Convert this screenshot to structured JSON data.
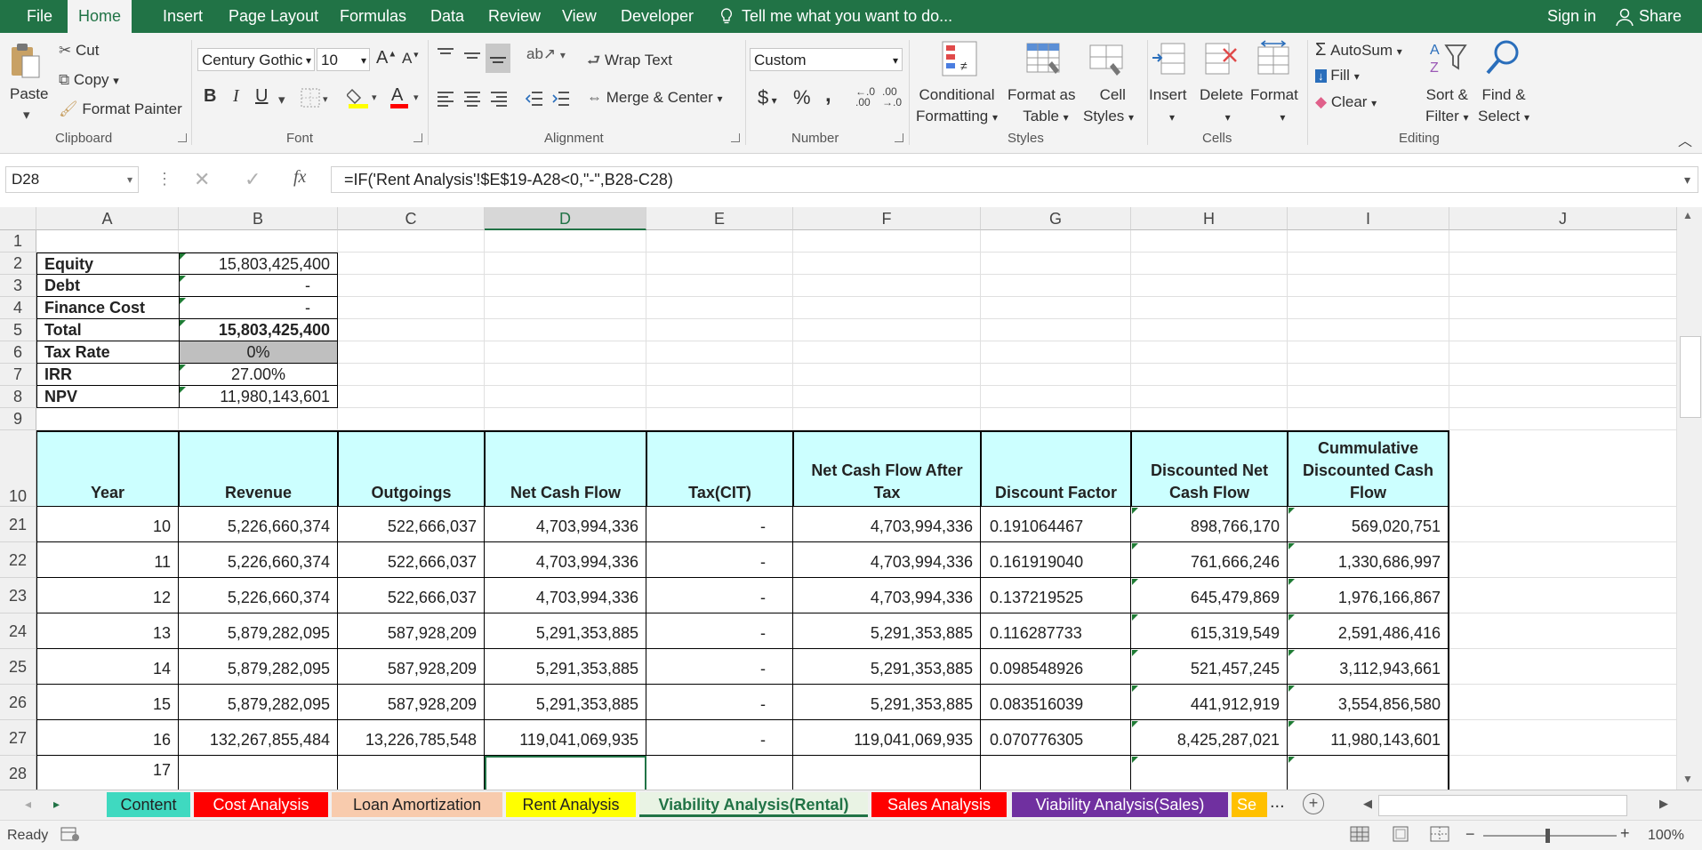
{
  "menu": {
    "file": "File",
    "home": "Home",
    "insert": "Insert",
    "page_layout": "Page Layout",
    "formulas": "Formulas",
    "data": "Data",
    "review": "Review",
    "view": "View",
    "developer": "Developer",
    "tell_me": "Tell me what you want to do...",
    "sign_in": "Sign in",
    "share": "Share"
  },
  "ribbon": {
    "clipboard": {
      "paste": "Paste",
      "cut": "Cut",
      "copy": "Copy",
      "format_painter": "Format Painter",
      "label": "Clipboard"
    },
    "font": {
      "name": "Century Gothic",
      "size": "10",
      "bold": "B",
      "italic": "I",
      "underline": "U",
      "label": "Font"
    },
    "alignment": {
      "wrap_text": "Wrap Text",
      "merge_center": "Merge & Center",
      "label": "Alignment"
    },
    "number": {
      "format": "Custom",
      "currency": "$",
      "percent": "%",
      "comma": ",",
      "label": "Number"
    },
    "styles": {
      "conditional_1": "Conditional",
      "conditional_2": "Formatting",
      "format_as_1": "Format as",
      "format_as_2": "Table",
      "cell_styles_1": "Cell",
      "cell_styles_2": "Styles",
      "label": "Styles"
    },
    "cells": {
      "insert": "Insert",
      "delete": "Delete",
      "format": "Format",
      "label": "Cells"
    },
    "editing": {
      "autosum": "AutoSum",
      "fill": "Fill",
      "clear": "Clear",
      "sort_1": "Sort &",
      "sort_2": "Filter",
      "find_1": "Find &",
      "find_2": "Select",
      "label": "Editing"
    }
  },
  "formula_bar": {
    "name_box": "D28",
    "fx": "fx",
    "formula": "=IF('Rent Analysis'!$E$19-A28<0,\"-\",B28-C28)"
  },
  "columns": [
    "A",
    "B",
    "C",
    "D",
    "E",
    "F",
    "G",
    "H",
    "I",
    "J"
  ],
  "summary": [
    {
      "row": "1",
      "label": "",
      "value": ""
    },
    {
      "row": "2",
      "label": "Equity",
      "value": "15,803,425,400"
    },
    {
      "row": "3",
      "label": "Debt",
      "value": "-"
    },
    {
      "row": "4",
      "label": "Finance Cost",
      "value": "-"
    },
    {
      "row": "5",
      "label": "Total",
      "value": "15,803,425,400"
    },
    {
      "row": "6",
      "label": "Tax Rate",
      "value": "0%"
    },
    {
      "row": "7",
      "label": "IRR",
      "value": "27.00%"
    },
    {
      "row": "8",
      "label": "NPV",
      "value": "11,980,143,601"
    },
    {
      "row": "9",
      "label": "",
      "value": ""
    }
  ],
  "table_header": {
    "row": "10",
    "cells": [
      "Year",
      "Revenue",
      "Outgoings",
      "Net Cash Flow",
      "Tax(CIT)",
      "Net Cash Flow After Tax",
      "Discount Factor",
      "Discounted Net Cash Flow",
      "Cummulative Discounted Cash Flow"
    ]
  },
  "table_rows": [
    {
      "row": "21",
      "cells": [
        "10",
        "5,226,660,374",
        "522,666,037",
        "4,703,994,336",
        "-",
        "4,703,994,336",
        "0.191064467",
        "898,766,170",
        "569,020,751"
      ]
    },
    {
      "row": "22",
      "cells": [
        "11",
        "5,226,660,374",
        "522,666,037",
        "4,703,994,336",
        "-",
        "4,703,994,336",
        "0.161919040",
        "761,666,246",
        "1,330,686,997"
      ]
    },
    {
      "row": "23",
      "cells": [
        "12",
        "5,226,660,374",
        "522,666,037",
        "4,703,994,336",
        "-",
        "4,703,994,336",
        "0.137219525",
        "645,479,869",
        "1,976,166,867"
      ]
    },
    {
      "row": "24",
      "cells": [
        "13",
        "5,879,282,095",
        "587,928,209",
        "5,291,353,885",
        "-",
        "5,291,353,885",
        "0.116287733",
        "615,319,549",
        "2,591,486,416"
      ]
    },
    {
      "row": "25",
      "cells": [
        "14",
        "5,879,282,095",
        "587,928,209",
        "5,291,353,885",
        "-",
        "5,291,353,885",
        "0.098548926",
        "521,457,245",
        "3,112,943,661"
      ]
    },
    {
      "row": "26",
      "cells": [
        "15",
        "5,879,282,095",
        "587,928,209",
        "5,291,353,885",
        "-",
        "5,291,353,885",
        "0.083516039",
        "441,912,919",
        "3,554,856,580"
      ]
    },
    {
      "row": "27",
      "cells": [
        "16",
        "132,267,855,484",
        "13,226,785,548",
        "119,041,069,935",
        "-",
        "119,041,069,935",
        "0.070776305",
        "8,425,287,021",
        "11,980,143,601"
      ]
    },
    {
      "row": "28",
      "cells": [
        "17",
        "",
        "",
        "",
        "",
        "",
        "",
        "",
        ""
      ]
    }
  ],
  "sheet_tabs": [
    {
      "label": "Content",
      "color": "#3fd9c0"
    },
    {
      "label": "Cost Analysis",
      "color": "#ff0000"
    },
    {
      "label": "Loan Amortization",
      "color": "#f8cbad"
    },
    {
      "label": "Rent Analysis",
      "color": "#ffff00"
    },
    {
      "label": "Viability Analysis(Rental)",
      "color": "#e2efda"
    },
    {
      "label": "Sales Analysis",
      "color": "#ff0000"
    },
    {
      "label": "Viability Analysis(Sales)",
      "color": "#7030a0"
    },
    {
      "label": "Se",
      "color": "#ffc000"
    }
  ],
  "tabs_more": "...",
  "status": {
    "ready": "Ready",
    "zoom": "100%"
  },
  "colors": {
    "excel_green": "#217346",
    "header_fill": "#ccffff",
    "tax_fill": "#bfbfbf"
  }
}
